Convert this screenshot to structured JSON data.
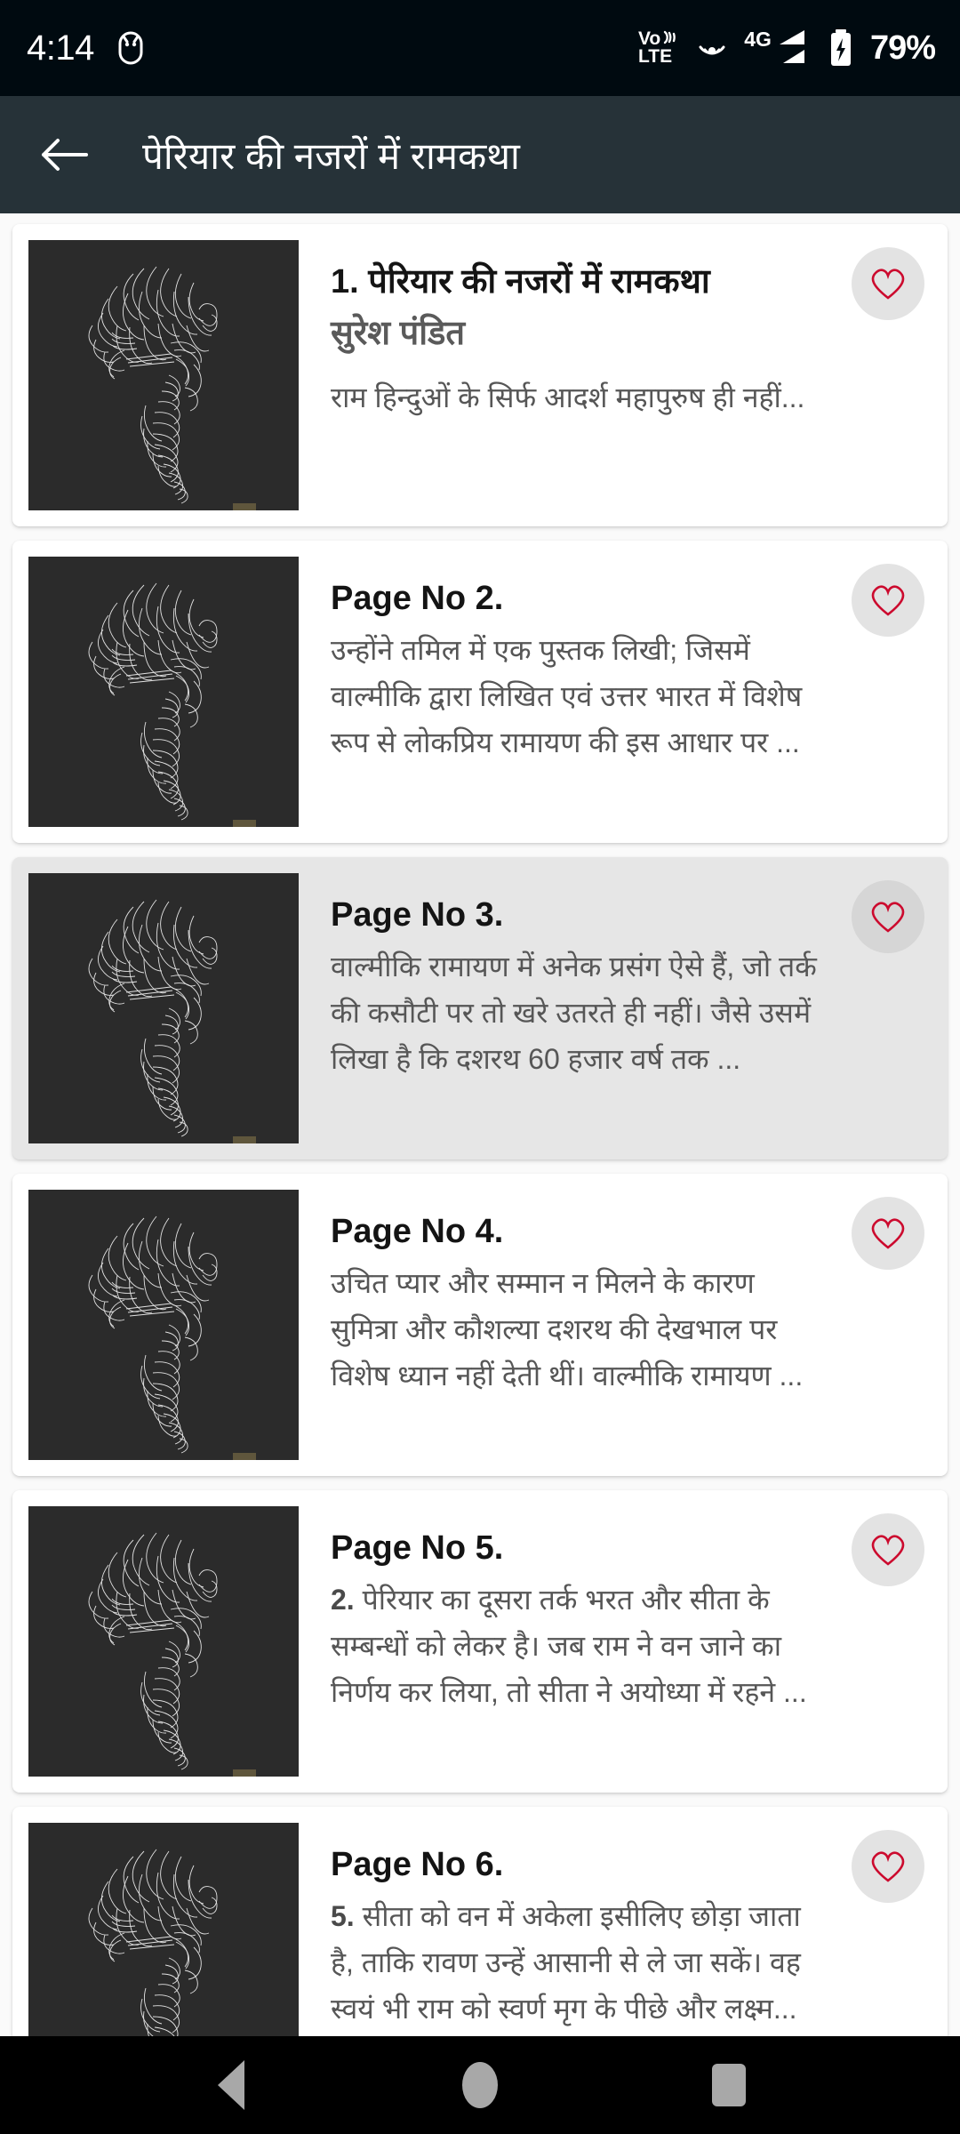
{
  "status_bar": {
    "time": "4:14",
    "left_icon": "android-debug-icon",
    "icons": [
      "volte-icon",
      "hotspot-icon",
      "4g-signal-icon",
      "battery-charging-icon"
    ],
    "network_label": "4G",
    "volte_top": "Vo",
    "volte_bottom": "LTE",
    "battery_percent": "79%",
    "background": "#000a10"
  },
  "app_bar": {
    "back_icon": "arrow-left-icon",
    "title": "पेरियार की नजरों में रामकथा",
    "background": "#263238",
    "text_color": "#ffffff"
  },
  "list": {
    "favorite_icon": "heart-outline-icon",
    "favorite_color": "#cc0a2e",
    "selected_card_background": "#e6e6e6",
    "thumbnail_background": "#2b2b2b",
    "items": [
      {
        "thumbnail": "periyar-sketch-thumbnail",
        "title": "1. पेरियार की नजरों में रामकथा",
        "author": "सुरेश पंडित",
        "snippet": "राम हिन्दुओं के सिर्फ आदर्श महापुरुष ही नहीं...",
        "selected": false,
        "favorited": false
      },
      {
        "thumbnail": "periyar-sketch-thumbnail",
        "title": "Page No 2.",
        "author": "",
        "snippet": "उन्होंने तमिल में एक पुस्तक लिखी; जिसमें वाल्मीकि द्वारा लिखित एवं उत्तर भारत में विशेष रूप से लोकप्रिय रामायण की इस आधार पर ...",
        "selected": false,
        "favorited": false
      },
      {
        "thumbnail": "periyar-sketch-thumbnail",
        "title": "Page No 3.",
        "author": "",
        "snippet": "वाल्मीकि रामायण में अनेक प्रसंग ऐसे हैं, जो तर्क की कसौटी पर तो खरे उतरते ही नहीं। जैसे उसमें लिखा है कि दशरथ 60 हजार वर्ष तक ...",
        "selected": true,
        "favorited": false
      },
      {
        "thumbnail": "periyar-sketch-thumbnail",
        "title": "Page No 4.",
        "author": "",
        "snippet": "उचित प्यार और सम्मान न मिलने के कारण सुमित्रा और कौशल्या दशरथ की देखभाल पर विशेष ध्यान नहीं देती थीं। वाल्मीकि रामायण ...",
        "selected": false,
        "favorited": false
      },
      {
        "thumbnail": "periyar-sketch-thumbnail",
        "title": "Page No 5.",
        "author": "",
        "snippet_lead": "2.",
        "snippet": " पेरियार का दूसरा तर्क भरत और सीता के सम्बन्धों को लेकर है। जब राम ने वन जाने का निर्णय कर लिया, तो सीता ने अयोध्या में रहने ...",
        "selected": false,
        "favorited": false
      },
      {
        "thumbnail": "periyar-sketch-thumbnail",
        "title": "Page No 6.",
        "author": "",
        "snippet_lead": "5.",
        "snippet": " सीता को वन में अकेला इसीलिए छोड़ा जाता है, ताकि रावण उन्हें आसानी से ले जा सकें। वह स्वयं भी राम को स्वर्ण मृग के पीछे और लक्ष्म...",
        "selected": false,
        "favorited": false
      }
    ]
  },
  "nav_bar": {
    "background": "#000000",
    "buttons": [
      {
        "name": "back-nav-button",
        "icon": "triangle-back-icon"
      },
      {
        "name": "home-nav-button",
        "icon": "circle-home-icon"
      },
      {
        "name": "recents-nav-button",
        "icon": "square-recents-icon"
      }
    ]
  }
}
